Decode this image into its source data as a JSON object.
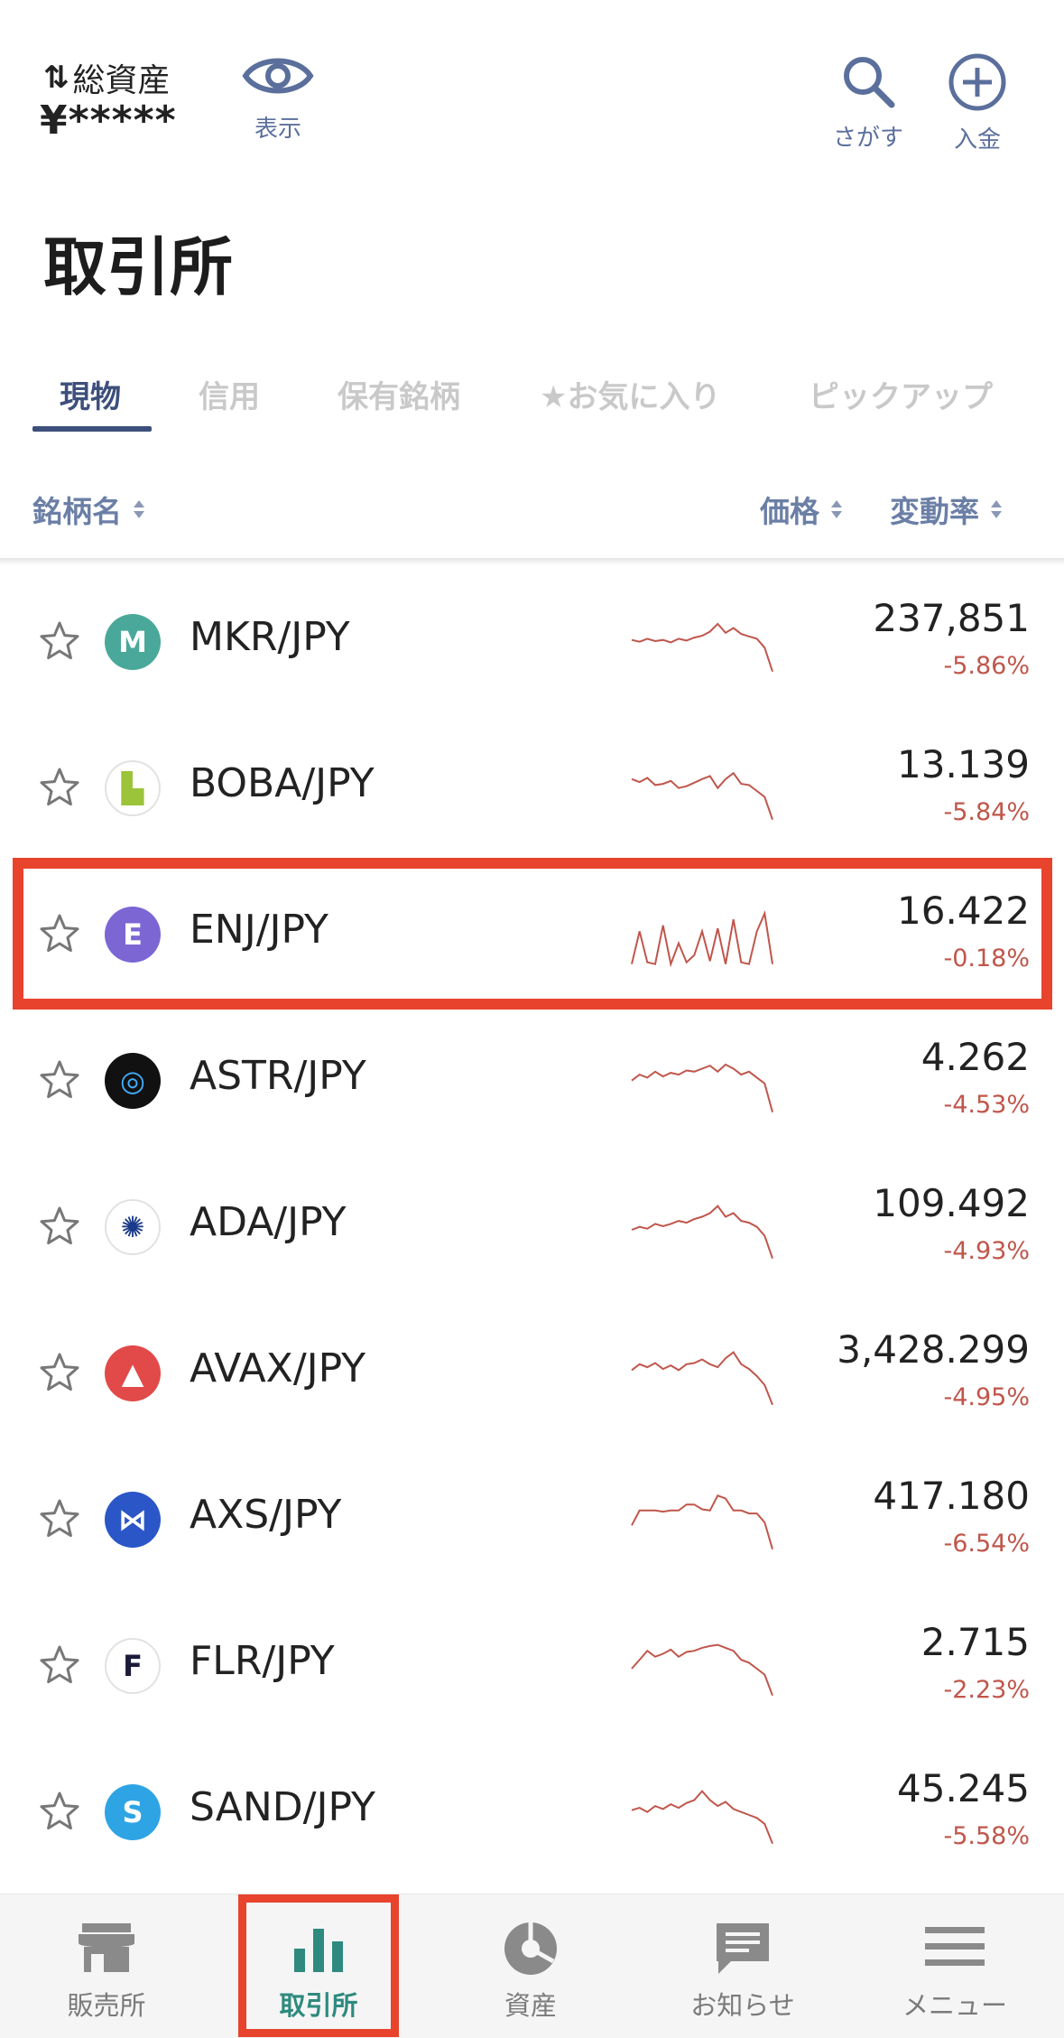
{
  "header": {
    "total_assets_label": "総資産",
    "total_assets_value": "¥*****",
    "show_label": "表示",
    "search_label": "さがす",
    "deposit_label": "入金"
  },
  "page_title": "取引所",
  "tabs": [
    {
      "label": "現物",
      "active": true
    },
    {
      "label": "信用",
      "active": false
    },
    {
      "label": "保有銘柄",
      "active": false
    },
    {
      "label": "★お気に入り",
      "active": false
    },
    {
      "label": "ピックアップ",
      "active": false
    }
  ],
  "columns": {
    "name": "銘柄名",
    "price": "価格",
    "change": "変動率"
  },
  "rows": [
    {
      "pair": "MKR/JPY",
      "price": "237,851",
      "change": "-5.86%",
      "icon_color": "#4aa89a",
      "icon": "mkr-icon"
    },
    {
      "pair": "BOBA/JPY",
      "price": "13.139",
      "change": "-5.84%",
      "icon_color": "#ffffff",
      "icon": "boba-icon"
    },
    {
      "pair": "ENJ/JPY",
      "price": "16.422",
      "change": "-0.18%",
      "icon_color": "#7b66d4",
      "icon": "enj-icon"
    },
    {
      "pair": "ASTR/JPY",
      "price": "4.262",
      "change": "-4.53%",
      "icon_color": "#111111",
      "icon": "astr-icon"
    },
    {
      "pair": "ADA/JPY",
      "price": "109.492",
      "change": "-4.93%",
      "icon_color": "#ffffff",
      "icon": "ada-icon"
    },
    {
      "pair": "AVAX/JPY",
      "price": "3,428.299",
      "change": "-4.95%",
      "icon_color": "#e14a49",
      "icon": "avax-icon"
    },
    {
      "pair": "AXS/JPY",
      "price": "417.180",
      "change": "-6.54%",
      "icon_color": "#2a56c8",
      "icon": "axs-icon"
    },
    {
      "pair": "FLR/JPY",
      "price": "2.715",
      "change": "-2.23%",
      "icon_color": "#ffffff",
      "icon": "flr-icon"
    },
    {
      "pair": "SAND/JPY",
      "price": "45.245",
      "change": "-5.58%",
      "icon_color": "#2ea4e4",
      "icon": "sand-icon"
    }
  ],
  "bottom_nav": [
    {
      "label": "販売所",
      "icon": "store-icon",
      "active": false
    },
    {
      "label": "取引所",
      "icon": "bar-chart-icon",
      "active": true
    },
    {
      "label": "資産",
      "icon": "pie-chart-icon",
      "active": false
    },
    {
      "label": "お知らせ",
      "icon": "message-icon",
      "active": false
    },
    {
      "label": "メニュー",
      "icon": "menu-icon",
      "active": false
    }
  ],
  "colors": {
    "accent": "#3d4f7b",
    "negative": "#c0564b",
    "active_nav": "#2e8a7e",
    "annotation_box": "#e8432d"
  }
}
